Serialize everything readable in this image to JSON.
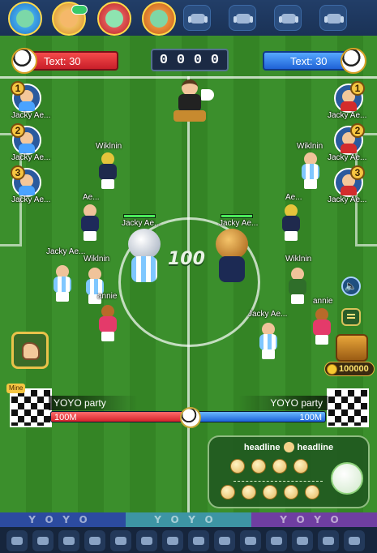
{
  "header": {
    "left_score_label": "Text: 30",
    "right_score_label": "Text: 30",
    "timer_digits": [
      "0",
      "0",
      "0",
      "0"
    ]
  },
  "field": {
    "center_value": "100",
    "left_team_slots": [
      {
        "rank": "1",
        "name": "Jacky Ae..."
      },
      {
        "rank": "2",
        "name": "Jacky Ae..."
      },
      {
        "rank": "3",
        "name": "Jacky Ae..."
      }
    ],
    "right_team_slots": [
      {
        "rank": "1",
        "name": "Jacky Ae..."
      },
      {
        "rank": "2",
        "name": "Jacky Ae..."
      },
      {
        "rank": "3",
        "name": "Jacky Ae..."
      }
    ],
    "player_names": {
      "wiklnin_left_top": "Wiklnin",
      "ae_left": "Ae...",
      "jacky_left": "Jacky Ae...",
      "wiklnin_left_mid": "Wiklnin",
      "annie_left": "annie",
      "mascot_left": "Jacky Ae...",
      "mascot_right": "Jacky Ae...",
      "wiklnin_right_top": "Wiklnin",
      "ae_right": "Ae...",
      "wiklnin_right_mid": "Wiklnin",
      "annie_right": "annie",
      "jacky_right": "Jacky Ae..."
    }
  },
  "widgets": {
    "coins": "100000",
    "sound_icon": "speaker-icon"
  },
  "bottom": {
    "mine_tag": "Mine",
    "left_team_name": "YOYO party",
    "right_team_name": "YOYO party",
    "left_amount": "100M",
    "right_amount": "100M",
    "left_share": 0.5,
    "right_share": 0.5
  },
  "card": {
    "headline_left": "headline",
    "headline_right": "headline"
  },
  "footer": {
    "strip_text": [
      "YOYO",
      "YOYO",
      "YOYO"
    ]
  },
  "colors": {
    "red_team": "#d3222a",
    "blue_team": "#1c62d9",
    "pitch": "#3b8f2c"
  }
}
